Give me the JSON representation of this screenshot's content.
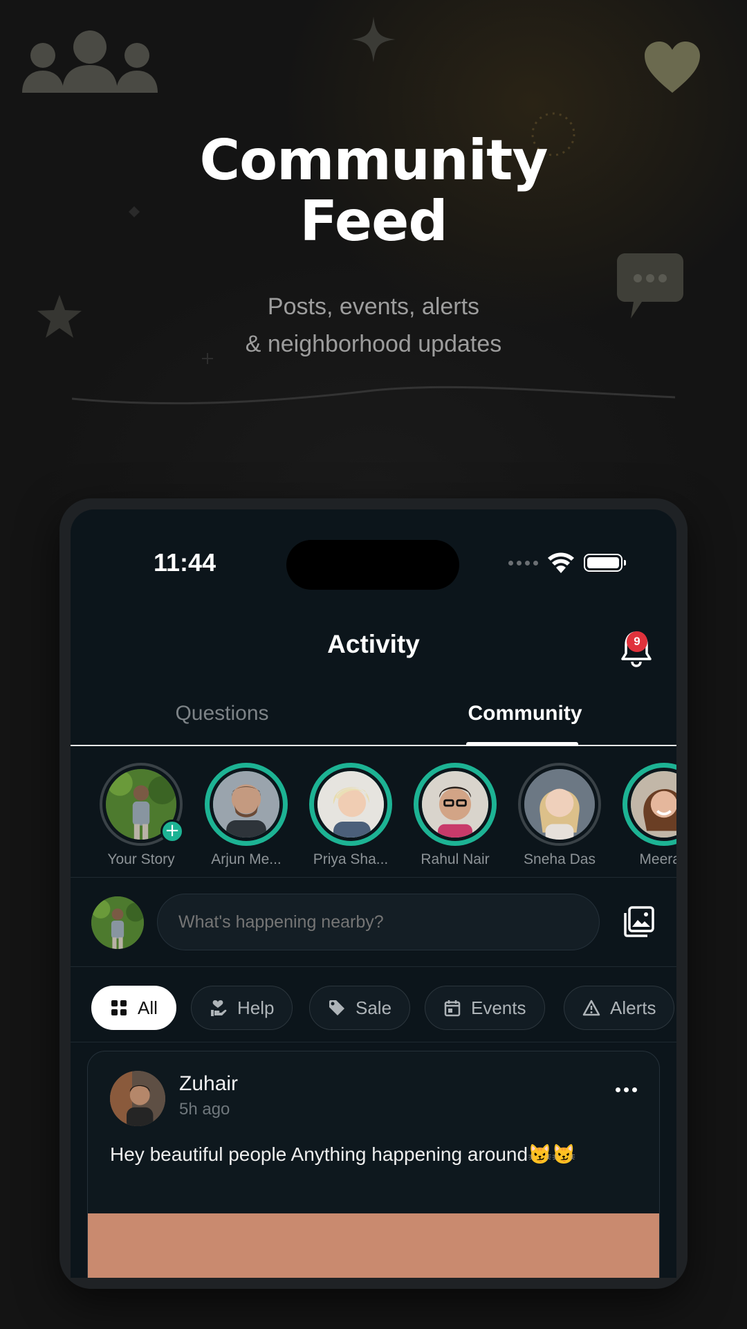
{
  "promo": {
    "title_line1": "Community",
    "title_line2": "Feed",
    "subtitle_line1": "Posts, events, alerts",
    "subtitle_line2": "& neighborhood updates"
  },
  "status_bar": {
    "time": "11:44"
  },
  "header": {
    "title": "Activity",
    "notification_count": "9"
  },
  "tabs": [
    {
      "label": "Questions",
      "active": false
    },
    {
      "label": "Community",
      "active": true
    }
  ],
  "stories": [
    {
      "name": "Your Story",
      "seen": true,
      "is_self": true
    },
    {
      "name": "Arjun Me...",
      "seen": false
    },
    {
      "name": "Priya Sha...",
      "seen": false
    },
    {
      "name": "Rahul Nair",
      "seen": false
    },
    {
      "name": "Sneha Das",
      "seen": true
    },
    {
      "name": "Meera I",
      "seen": false
    }
  ],
  "composer": {
    "placeholder": "What's happening nearby?"
  },
  "filters": [
    {
      "label": "All",
      "icon": "grid-icon",
      "active": true
    },
    {
      "label": "Help",
      "icon": "helping-hand-icon",
      "active": false
    },
    {
      "label": "Sale",
      "icon": "tag-icon",
      "active": false
    },
    {
      "label": "Events",
      "icon": "calendar-icon",
      "active": false
    },
    {
      "label": "Alerts",
      "icon": "warning-icon",
      "active": false
    }
  ],
  "post": {
    "author": "Zuhair",
    "time": "5h ago",
    "text": "Hey beautiful people Anything happening around😼😼"
  },
  "colors": {
    "accent": "#1db394",
    "badge": "#e0323c",
    "screen_bg": "#0c151b"
  }
}
